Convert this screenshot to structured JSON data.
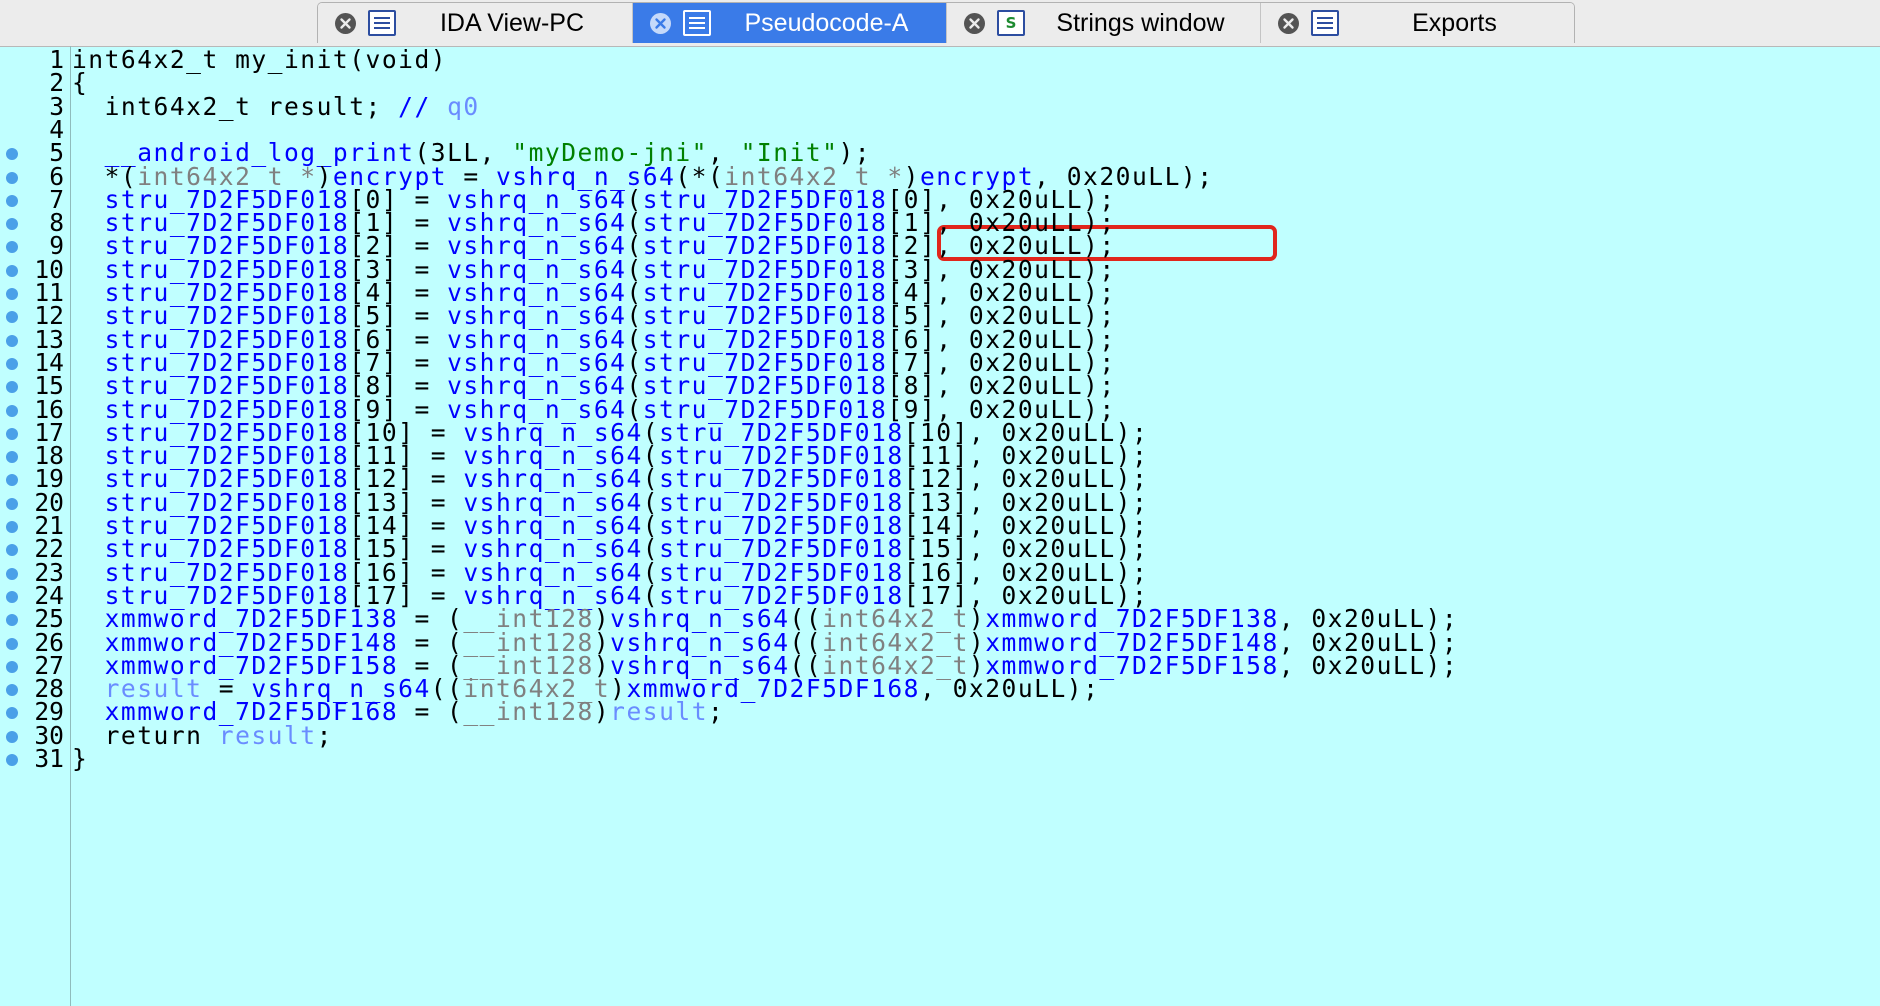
{
  "tabs": [
    {
      "label": "IDA View-PC",
      "icon": "disassembly-view-icon",
      "active": false
    },
    {
      "label": "Pseudocode-A",
      "icon": "pseudocode-icon",
      "active": true
    },
    {
      "label": "Strings window",
      "icon": "strings-icon",
      "active": false
    },
    {
      "label": "Exports",
      "icon": "exports-icon",
      "active": false
    }
  ],
  "colors": {
    "editor_background": "#c0ffff",
    "identifier": "#0000ff",
    "comment_ref": "#6a8cff",
    "string_literal": "#008000",
    "cast_type": "#808080",
    "highlight_box": "#e0261c",
    "active_tab": "#3a7be8"
  },
  "code": {
    "lines": [
      {
        "n": "1",
        "bp": false,
        "t": [
          [
            "k",
            "int64x2_t my_init(void)"
          ]
        ]
      },
      {
        "n": "2",
        "bp": false,
        "t": [
          [
            "k",
            "{"
          ]
        ]
      },
      {
        "n": "3",
        "bp": false,
        "t": [
          [
            "k",
            "  int64x2_t result; "
          ],
          [
            "id",
            "// "
          ],
          [
            "lb",
            "q0"
          ]
        ]
      },
      {
        "n": "4",
        "bp": false,
        "t": []
      },
      {
        "n": "5",
        "bp": true,
        "t": [
          [
            "k",
            "  "
          ],
          [
            "id",
            "__android_log_print"
          ],
          [
            "k",
            "(3LL, "
          ],
          [
            "gr",
            "\"myDemo-jni\""
          ],
          [
            "k",
            ", "
          ],
          [
            "gr",
            "\"Init\""
          ],
          [
            "k",
            ");"
          ]
        ]
      },
      {
        "n": "6",
        "bp": true,
        "t": [
          [
            "k",
            "  *("
          ],
          [
            "gy",
            "int64x2_t *"
          ],
          [
            "k",
            ")"
          ],
          [
            "id",
            "encrypt"
          ],
          [
            "k",
            " = "
          ],
          [
            "id",
            "vshrq_n_s64"
          ],
          [
            "k",
            "(*("
          ],
          [
            "gy",
            "int64x2_t *"
          ],
          [
            "k",
            ")"
          ],
          [
            "id",
            "encrypt"
          ],
          [
            "k",
            ", 0x20uLL);"
          ]
        ]
      },
      {
        "n": "7",
        "bp": true,
        "t": [
          [
            "id",
            "  stru_7D2F5DF018"
          ],
          [
            "k",
            "[0] = "
          ],
          [
            "id",
            "vshrq_n_s64"
          ],
          [
            "k",
            "("
          ],
          [
            "id",
            "stru_7D2F5DF018"
          ],
          [
            "k",
            "[0], 0x20uLL);"
          ]
        ]
      },
      {
        "n": "8",
        "bp": true,
        "t": [
          [
            "id",
            "  stru_7D2F5DF018"
          ],
          [
            "k",
            "[1] = "
          ],
          [
            "id",
            "vshrq_n_s64"
          ],
          [
            "k",
            "("
          ],
          [
            "id",
            "stru_7D2F5DF018"
          ],
          [
            "k",
            "[1], 0x20uLL);"
          ]
        ]
      },
      {
        "n": "9",
        "bp": true,
        "t": [
          [
            "id",
            "  stru_7D2F5DF018"
          ],
          [
            "k",
            "[2] = "
          ],
          [
            "id",
            "vshrq_n_s64"
          ],
          [
            "k",
            "("
          ],
          [
            "id",
            "stru_7D2F5DF018"
          ],
          [
            "k",
            "[2], 0x20uLL);"
          ]
        ]
      },
      {
        "n": "10",
        "bp": true,
        "t": [
          [
            "id",
            "  stru_7D2F5DF018"
          ],
          [
            "k",
            "[3] = "
          ],
          [
            "id",
            "vshrq_n_s64"
          ],
          [
            "k",
            "("
          ],
          [
            "id",
            "stru_7D2F5DF018"
          ],
          [
            "k",
            "[3], 0x20uLL);"
          ]
        ]
      },
      {
        "n": "11",
        "bp": true,
        "t": [
          [
            "id",
            "  stru_7D2F5DF018"
          ],
          [
            "k",
            "[4] = "
          ],
          [
            "id",
            "vshrq_n_s64"
          ],
          [
            "k",
            "("
          ],
          [
            "id",
            "stru_7D2F5DF018"
          ],
          [
            "k",
            "[4], 0x20uLL);"
          ]
        ]
      },
      {
        "n": "12",
        "bp": true,
        "t": [
          [
            "id",
            "  stru_7D2F5DF018"
          ],
          [
            "k",
            "[5] = "
          ],
          [
            "id",
            "vshrq_n_s64"
          ],
          [
            "k",
            "("
          ],
          [
            "id",
            "stru_7D2F5DF018"
          ],
          [
            "k",
            "[5], 0x20uLL);"
          ]
        ]
      },
      {
        "n": "13",
        "bp": true,
        "t": [
          [
            "id",
            "  stru_7D2F5DF018"
          ],
          [
            "k",
            "[6] = "
          ],
          [
            "id",
            "vshrq_n_s64"
          ],
          [
            "k",
            "("
          ],
          [
            "id",
            "stru_7D2F5DF018"
          ],
          [
            "k",
            "[6], 0x20uLL);"
          ]
        ]
      },
      {
        "n": "14",
        "bp": true,
        "t": [
          [
            "id",
            "  stru_7D2F5DF018"
          ],
          [
            "k",
            "[7] = "
          ],
          [
            "id",
            "vshrq_n_s64"
          ],
          [
            "k",
            "("
          ],
          [
            "id",
            "stru_7D2F5DF018"
          ],
          [
            "k",
            "[7], 0x20uLL);"
          ]
        ]
      },
      {
        "n": "15",
        "bp": true,
        "t": [
          [
            "id",
            "  stru_7D2F5DF018"
          ],
          [
            "k",
            "[8] = "
          ],
          [
            "id",
            "vshrq_n_s64"
          ],
          [
            "k",
            "("
          ],
          [
            "id",
            "stru_7D2F5DF018"
          ],
          [
            "k",
            "[8], 0x20uLL);"
          ]
        ]
      },
      {
        "n": "16",
        "bp": true,
        "t": [
          [
            "id",
            "  stru_7D2F5DF018"
          ],
          [
            "k",
            "[9] = "
          ],
          [
            "id",
            "vshrq_n_s64"
          ],
          [
            "k",
            "("
          ],
          [
            "id",
            "stru_7D2F5DF018"
          ],
          [
            "k",
            "[9], 0x20uLL);"
          ]
        ]
      },
      {
        "n": "17",
        "bp": true,
        "t": [
          [
            "id",
            "  stru_7D2F5DF018"
          ],
          [
            "k",
            "[10] = "
          ],
          [
            "id",
            "vshrq_n_s64"
          ],
          [
            "k",
            "("
          ],
          [
            "id",
            "stru_7D2F5DF018"
          ],
          [
            "k",
            "[10], 0x20uLL);"
          ]
        ]
      },
      {
        "n": "18",
        "bp": true,
        "t": [
          [
            "id",
            "  stru_7D2F5DF018"
          ],
          [
            "k",
            "[11] = "
          ],
          [
            "id",
            "vshrq_n_s64"
          ],
          [
            "k",
            "("
          ],
          [
            "id",
            "stru_7D2F5DF018"
          ],
          [
            "k",
            "[11], 0x20uLL);"
          ]
        ]
      },
      {
        "n": "19",
        "bp": true,
        "t": [
          [
            "id",
            "  stru_7D2F5DF018"
          ],
          [
            "k",
            "[12] = "
          ],
          [
            "id",
            "vshrq_n_s64"
          ],
          [
            "k",
            "("
          ],
          [
            "id",
            "stru_7D2F5DF018"
          ],
          [
            "k",
            "[12], 0x20uLL);"
          ]
        ]
      },
      {
        "n": "20",
        "bp": true,
        "t": [
          [
            "id",
            "  stru_7D2F5DF018"
          ],
          [
            "k",
            "[13] = "
          ],
          [
            "id",
            "vshrq_n_s64"
          ],
          [
            "k",
            "("
          ],
          [
            "id",
            "stru_7D2F5DF018"
          ],
          [
            "k",
            "[13], 0x20uLL);"
          ]
        ]
      },
      {
        "n": "21",
        "bp": true,
        "t": [
          [
            "id",
            "  stru_7D2F5DF018"
          ],
          [
            "k",
            "[14] = "
          ],
          [
            "id",
            "vshrq_n_s64"
          ],
          [
            "k",
            "("
          ],
          [
            "id",
            "stru_7D2F5DF018"
          ],
          [
            "k",
            "[14], 0x20uLL);"
          ]
        ]
      },
      {
        "n": "22",
        "bp": true,
        "t": [
          [
            "id",
            "  stru_7D2F5DF018"
          ],
          [
            "k",
            "[15] = "
          ],
          [
            "id",
            "vshrq_n_s64"
          ],
          [
            "k",
            "("
          ],
          [
            "id",
            "stru_7D2F5DF018"
          ],
          [
            "k",
            "[15], 0x20uLL);"
          ]
        ]
      },
      {
        "n": "23",
        "bp": true,
        "t": [
          [
            "id",
            "  stru_7D2F5DF018"
          ],
          [
            "k",
            "[16] = "
          ],
          [
            "id",
            "vshrq_n_s64"
          ],
          [
            "k",
            "("
          ],
          [
            "id",
            "stru_7D2F5DF018"
          ],
          [
            "k",
            "[16], 0x20uLL);"
          ]
        ]
      },
      {
        "n": "24",
        "bp": true,
        "t": [
          [
            "id",
            "  stru_7D2F5DF018"
          ],
          [
            "k",
            "[17] = "
          ],
          [
            "id",
            "vshrq_n_s64"
          ],
          [
            "k",
            "("
          ],
          [
            "id",
            "stru_7D2F5DF018"
          ],
          [
            "k",
            "[17], 0x20uLL);"
          ]
        ]
      },
      {
        "n": "25",
        "bp": true,
        "t": [
          [
            "id",
            "  xmmword_7D2F5DF138"
          ],
          [
            "k",
            " = ("
          ],
          [
            "gy",
            "__int128"
          ],
          [
            "k",
            ")"
          ],
          [
            "id",
            "vshrq_n_s64"
          ],
          [
            "k",
            "(("
          ],
          [
            "gy",
            "int64x2_t"
          ],
          [
            "k",
            ")"
          ],
          [
            "id",
            "xmmword_7D2F5DF138"
          ],
          [
            "k",
            ", 0x20uLL);"
          ]
        ]
      },
      {
        "n": "26",
        "bp": true,
        "t": [
          [
            "id",
            "  xmmword_7D2F5DF148"
          ],
          [
            "k",
            " = ("
          ],
          [
            "gy",
            "__int128"
          ],
          [
            "k",
            ")"
          ],
          [
            "id",
            "vshrq_n_s64"
          ],
          [
            "k",
            "(("
          ],
          [
            "gy",
            "int64x2_t"
          ],
          [
            "k",
            ")"
          ],
          [
            "id",
            "xmmword_7D2F5DF148"
          ],
          [
            "k",
            ", 0x20uLL);"
          ]
        ]
      },
      {
        "n": "27",
        "bp": true,
        "t": [
          [
            "id",
            "  xmmword_7D2F5DF158"
          ],
          [
            "k",
            " = ("
          ],
          [
            "gy",
            "__int128"
          ],
          [
            "k",
            ")"
          ],
          [
            "id",
            "vshrq_n_s64"
          ],
          [
            "k",
            "(("
          ],
          [
            "gy",
            "int64x2_t"
          ],
          [
            "k",
            ")"
          ],
          [
            "id",
            "xmmword_7D2F5DF158"
          ],
          [
            "k",
            ", 0x20uLL);"
          ]
        ]
      },
      {
        "n": "28",
        "bp": true,
        "t": [
          [
            "lb",
            "  result"
          ],
          [
            "k",
            " = "
          ],
          [
            "id",
            "vshrq_n_s64"
          ],
          [
            "k",
            "(("
          ],
          [
            "gy",
            "int64x2_t"
          ],
          [
            "k",
            ")"
          ],
          [
            "id",
            "xmmword_7D2F5DF168"
          ],
          [
            "k",
            ", 0x20uLL);"
          ]
        ]
      },
      {
        "n": "29",
        "bp": true,
        "t": [
          [
            "id",
            "  xmmword_7D2F5DF168"
          ],
          [
            "k",
            " = ("
          ],
          [
            "gy",
            "__int128"
          ],
          [
            "k",
            ")"
          ],
          [
            "lb",
            "result"
          ],
          [
            "k",
            ";"
          ]
        ]
      },
      {
        "n": "30",
        "bp": true,
        "t": [
          [
            "k",
            "  return "
          ],
          [
            "lb",
            "result"
          ],
          [
            "k",
            ";"
          ]
        ]
      },
      {
        "n": "31",
        "bp": true,
        "t": [
          [
            "k",
            "}"
          ]
        ]
      }
    ]
  }
}
